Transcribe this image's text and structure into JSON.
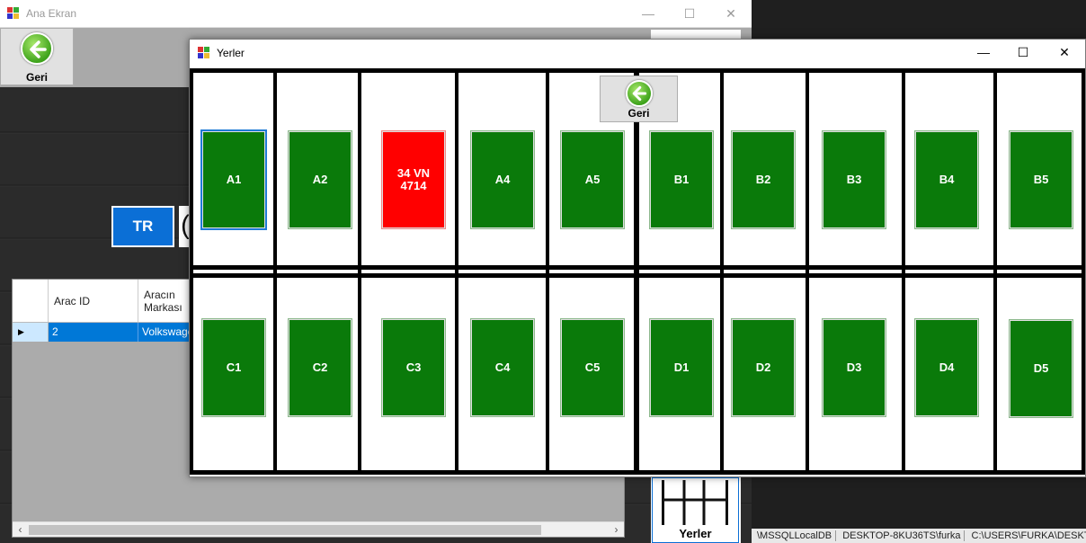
{
  "main_window": {
    "title": "Ana Ekran",
    "geri_label": "Geri",
    "lang_button": "TR",
    "next_button_glyph": "(",
    "grid": {
      "columns": [
        "Arac ID",
        "Aracın Markası"
      ],
      "rows": [
        {
          "arac_id": "2",
          "marka": "Volkswagen"
        }
      ]
    },
    "yerler_label": "Yerler",
    "status": [
      "\\MSSQLLocalDB",
      "DESKTOP-8KU36TS\\furka",
      "C:\\USERS\\FURKA\\DESKTO"
    ]
  },
  "yerler_window": {
    "title": "Yerler",
    "geri_label": "Geri",
    "top_row": [
      {
        "label": "A1",
        "state": "selected"
      },
      {
        "label": "A2",
        "state": "empty"
      },
      {
        "label": "34 VN 4714",
        "state": "occupied"
      },
      {
        "label": "A4",
        "state": "empty"
      },
      {
        "label": "A5",
        "state": "empty"
      },
      {
        "label": "B1",
        "state": "empty"
      },
      {
        "label": "B2",
        "state": "empty"
      },
      {
        "label": "B3",
        "state": "empty"
      },
      {
        "label": "B4",
        "state": "empty"
      },
      {
        "label": "B5",
        "state": "empty"
      }
    ],
    "bottom_row": [
      {
        "label": "C1",
        "state": "empty"
      },
      {
        "label": "C2",
        "state": "empty"
      },
      {
        "label": "C3",
        "state": "empty"
      },
      {
        "label": "C4",
        "state": "empty"
      },
      {
        "label": "C5",
        "state": "empty"
      },
      {
        "label": "D1",
        "state": "empty"
      },
      {
        "label": "D2",
        "state": "empty"
      },
      {
        "label": "D3",
        "state": "empty"
      },
      {
        "label": "D4",
        "state": "empty"
      },
      {
        "label": "D5",
        "state": "empty"
      }
    ]
  },
  "colors": {
    "empty_spot": "#0a7a0a",
    "occupied_spot": "#ff0000",
    "accent": "#0b6fd6"
  }
}
